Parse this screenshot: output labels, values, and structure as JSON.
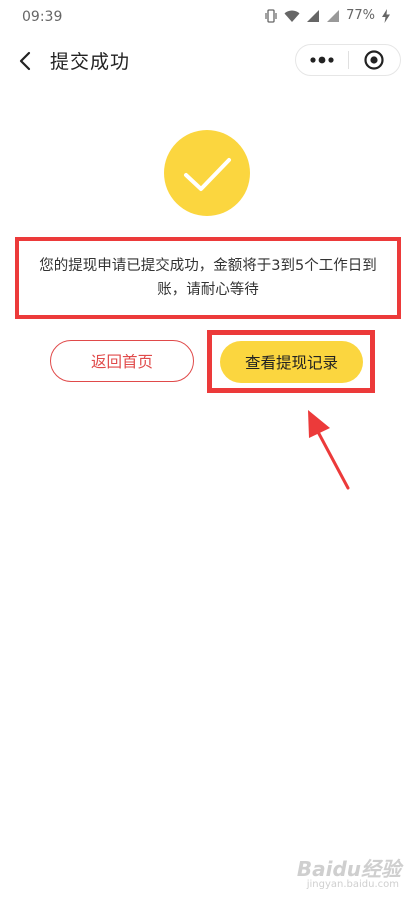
{
  "status_bar": {
    "time": "09:39",
    "battery": "77%"
  },
  "nav": {
    "title": "提交成功"
  },
  "message": "您的提现申请已提交成功，金额将于3到5个工作日到账，请耐心等待",
  "buttons": {
    "home": "返回首页",
    "records": "查看提现记录"
  },
  "watermark": {
    "brand": "Baidu经验",
    "url": "jingyan.baidu.com"
  },
  "colors": {
    "accent_yellow": "#fbd63f",
    "annotation_red": "#ec3a3a",
    "button_red": "#e04a4a"
  }
}
